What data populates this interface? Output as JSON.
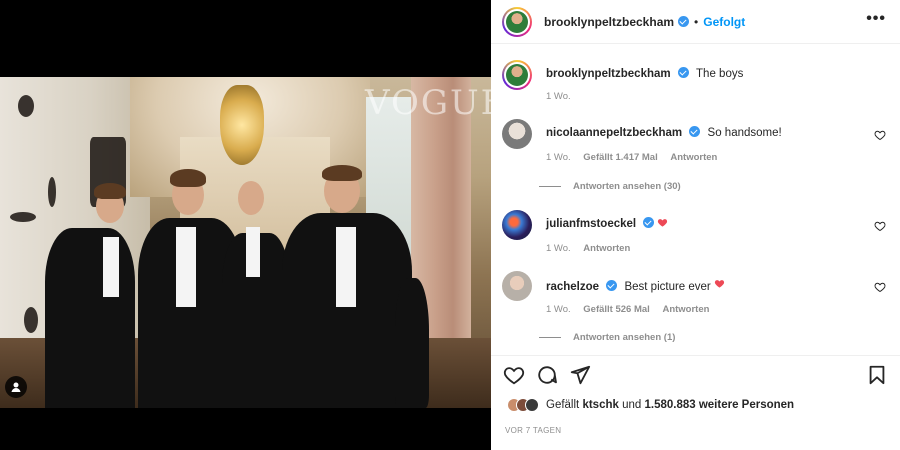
{
  "post": {
    "author": "brooklynpeltzbeckham",
    "follow_state": "Gefolgt",
    "separator": "•",
    "more_glyph": "•••",
    "photo_watermark": "VOGUE"
  },
  "caption": {
    "user": "brooklynpeltzbeckham",
    "text": "The boys",
    "time": "1 Wo."
  },
  "comments": [
    {
      "user": "nicolaannepeltzbeckham",
      "text": "So handsome!",
      "time": "1 Wo.",
      "likes": "Gefällt 1.417 Mal",
      "reply": "Antworten",
      "view_replies": "Antworten ansehen (30)",
      "verified": true
    },
    {
      "user": "julianfmstoeckel",
      "text": "",
      "time": "1 Wo.",
      "likes": "",
      "reply": "Antworten",
      "verified": true,
      "emoji": "heart-emoji"
    },
    {
      "user": "rachelzoe",
      "text": "Best picture ever",
      "time": "1 Wo.",
      "likes": "Gefällt 526 Mal",
      "reply": "Antworten",
      "view_replies": "Antworten ansehen (1)",
      "verified": true,
      "emoji": "heart-emoji"
    }
  ],
  "actions": {
    "icons": [
      "heart-icon",
      "comment-icon",
      "share-icon",
      "bookmark-icon"
    ]
  },
  "likes_line": {
    "prefix": "Gefällt",
    "user": "ktschk",
    "middle": "und",
    "count": "1.580.883 weitere Personen"
  },
  "timestamp": "VOR 7 TAGEN",
  "colors": {
    "link_blue": "#0095f6",
    "verified_blue": "#3897f0",
    "heart_red": "#ed4956",
    "meta_grey": "#8e8e8e"
  }
}
